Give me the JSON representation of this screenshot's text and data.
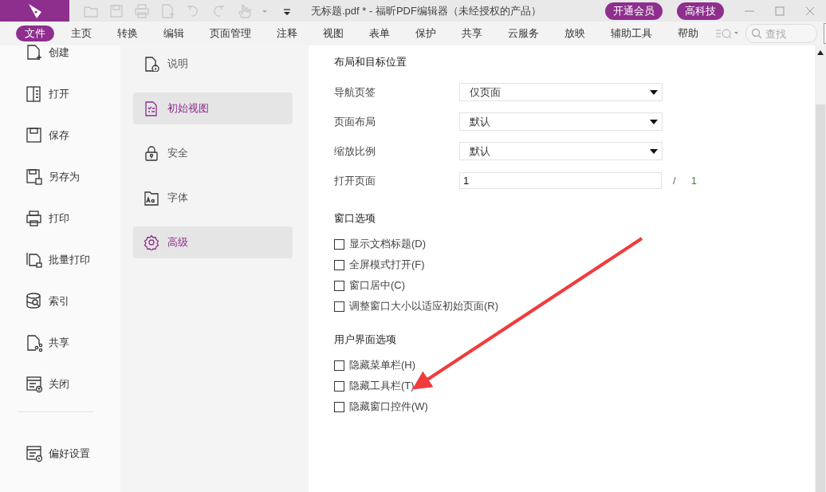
{
  "window": {
    "title": "无标题.pdf * - 福昕PDF编辑器（未经授权的产品）",
    "buttons": [
      "开通会员",
      "高科技"
    ]
  },
  "menu": {
    "tabs": [
      {
        "label": "文件",
        "selected": true
      },
      {
        "label": "主页",
        "selected": false
      },
      {
        "label": "转换",
        "selected": false
      },
      {
        "label": "编辑",
        "selected": false
      },
      {
        "label": "页面管理",
        "selected": false
      },
      {
        "label": "注释",
        "selected": false
      },
      {
        "label": "视图",
        "selected": false
      },
      {
        "label": "表单",
        "selected": false
      },
      {
        "label": "保护",
        "selected": false
      },
      {
        "label": "共享",
        "selected": false
      },
      {
        "label": "云服务",
        "selected": false
      },
      {
        "label": "放映",
        "selected": false
      },
      {
        "label": "辅助工具",
        "selected": false
      },
      {
        "label": "帮助",
        "selected": false
      }
    ],
    "search": {
      "placeholder": "查找"
    }
  },
  "sidebar": {
    "items": [
      {
        "label": "创建"
      },
      {
        "label": "打开"
      },
      {
        "label": "保存"
      },
      {
        "label": "另存为"
      },
      {
        "label": "打印"
      },
      {
        "label": "批量打印"
      },
      {
        "label": "索引"
      },
      {
        "label": "共享"
      },
      {
        "label": "关闭"
      }
    ],
    "footer": {
      "label": "偏好设置"
    }
  },
  "categories": [
    {
      "label": "说明",
      "selected": false
    },
    {
      "label": "初始视图",
      "selected": true
    },
    {
      "label": "安全",
      "selected": false
    },
    {
      "label": "字体",
      "selected": false
    },
    {
      "label": "高级",
      "selected": true
    }
  ],
  "sections": [
    {
      "title": "布局和目标位置",
      "fields": [
        {
          "kind": "select",
          "label": "导航页签",
          "value": "仅页面"
        },
        {
          "kind": "select",
          "label": "页面布局",
          "value": "默认"
        },
        {
          "kind": "select",
          "label": "缩放比例",
          "value": "默认"
        },
        {
          "kind": "page",
          "label": "打开页面",
          "value": "1",
          "separator": "/",
          "total": "1"
        }
      ]
    },
    {
      "title": "窗口选项",
      "options": [
        {
          "label": "显示文档标题(D)",
          "checked": false
        },
        {
          "label": "全屏模式打开(F)",
          "checked": false
        },
        {
          "label": "窗口居中(C)",
          "checked": false
        },
        {
          "label": "调整窗口大小以适应初始页面(R)",
          "checked": false
        }
      ]
    },
    {
      "title": "用户界面选项",
      "options": [
        {
          "label": "隐藏菜单栏(H)",
          "checked": false
        },
        {
          "label": "隐藏工具栏(T)",
          "checked": false
        },
        {
          "label": "隐藏窗口控件(W)",
          "checked": false
        }
      ]
    }
  ]
}
